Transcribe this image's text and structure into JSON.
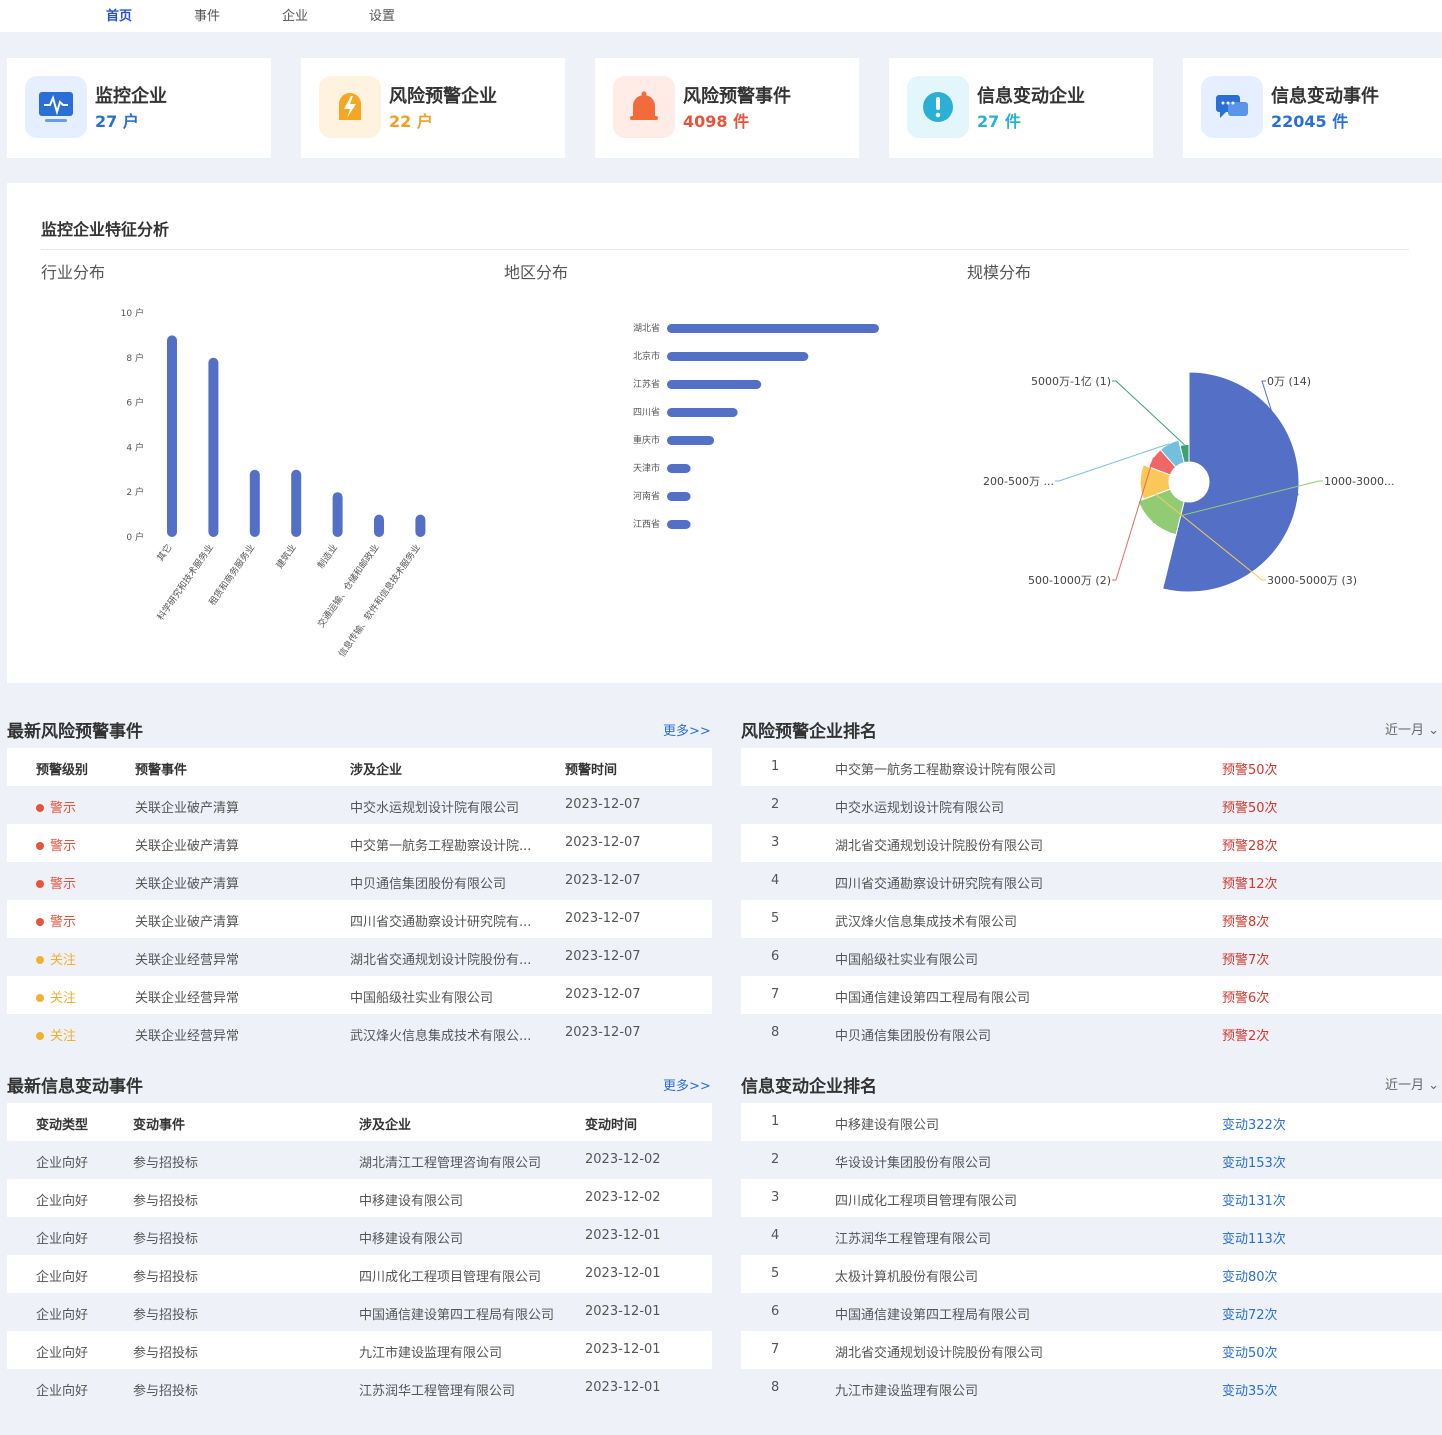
{
  "nav": [
    {
      "label": "首页",
      "active": true
    },
    {
      "label": "事件",
      "active": false
    },
    {
      "label": "企业",
      "active": false
    },
    {
      "label": "设置",
      "active": false
    }
  ],
  "stats": [
    {
      "label": "监控企业",
      "value": "27 户",
      "color": "#2a6fd6",
      "icon": "monitor-icon"
    },
    {
      "label": "风险预警企业",
      "value": "22 户",
      "color": "#f0a020",
      "icon": "lightning-icon"
    },
    {
      "label": "风险预警事件",
      "value": "4098 件",
      "color": "#e8533c",
      "icon": "bell-icon"
    },
    {
      "label": "信息变动企业",
      "value": "27 件",
      "color": "#2ab0d6",
      "icon": "exclamation-icon"
    },
    {
      "label": "信息变动事件",
      "value": "22045 件",
      "color": "#2a6fd6",
      "icon": "message-icon"
    }
  ],
  "analysis": {
    "title": "监控企业特征分析",
    "industry_title": "行业分布",
    "region_title": "地区分布",
    "scale_title": "规模分布"
  },
  "chart_data": [
    {
      "type": "bar",
      "categories": [
        "其它",
        "科学研究和技术服务业",
        "租赁和商务服务业",
        "建筑业",
        "制造业",
        "交通运输、仓储和邮政业",
        "信息传输、软件和信息技术服务业"
      ],
      "values": [
        9,
        8,
        3,
        3,
        2,
        1,
        1
      ],
      "yticks": [
        "0 户",
        "2 户",
        "4 户",
        "6 户",
        "8 户",
        "10 户"
      ],
      "ylim": [
        0,
        10
      ],
      "color": "#5470c6"
    },
    {
      "type": "bar",
      "orientation": "horizontal",
      "categories": [
        "湖北省",
        "北京市",
        "江苏省",
        "四川省",
        "重庆市",
        "天津市",
        "河南省",
        "江西省"
      ],
      "values": [
        9,
        6,
        4,
        3,
        2,
        1,
        1,
        1
      ],
      "color": "#5470c6"
    },
    {
      "type": "pie",
      "rose": true,
      "slices": [
        {
          "label": "0万 (14)",
          "value": 14,
          "color": "#5470c6"
        },
        {
          "label": "1000-3000...",
          "value": 4,
          "color": "#91cc75"
        },
        {
          "label": "3000-5000万 (3)",
          "value": 3,
          "color": "#fac858"
        },
        {
          "label": "500-1000万 (2)",
          "value": 2,
          "color": "#ee6666"
        },
        {
          "label": "200-500万 ...",
          "value": 2,
          "color": "#73c0de"
        },
        {
          "label": "5000万-1亿 (1)",
          "value": 1,
          "color": "#3ba272"
        }
      ]
    }
  ],
  "risk_events": {
    "title": "最新风险预警事件",
    "more": "更多>>",
    "headers": [
      "预警级别",
      "预警事件",
      "涉及企业",
      "预警时间"
    ],
    "rows": [
      {
        "level": "警示",
        "level_color": "#e8533c",
        "event": "关联企业破产清算",
        "company": "中交水运规划设计院有限公司",
        "time": "2023-12-07"
      },
      {
        "level": "警示",
        "level_color": "#e8533c",
        "event": "关联企业破产清算",
        "company": "中交第一航务工程勘察设计院...",
        "time": "2023-12-07"
      },
      {
        "level": "警示",
        "level_color": "#e8533c",
        "event": "关联企业破产清算",
        "company": "中贝通信集团股份有限公司",
        "time": "2023-12-07"
      },
      {
        "level": "警示",
        "level_color": "#e8533c",
        "event": "关联企业破产清算",
        "company": "四川省交通勘察设计研究院有...",
        "time": "2023-12-07"
      },
      {
        "level": "关注",
        "level_color": "#f0b030",
        "event": "关联企业经营异常",
        "company": "湖北省交通规划设计院股份有...",
        "time": "2023-12-07"
      },
      {
        "level": "关注",
        "level_color": "#f0b030",
        "event": "关联企业经营异常",
        "company": "中国船级社实业有限公司",
        "time": "2023-12-07"
      },
      {
        "level": "关注",
        "level_color": "#f0b030",
        "event": "关联企业经营异常",
        "company": "武汉烽火信息集成技术有限公...",
        "time": "2023-12-07"
      }
    ]
  },
  "risk_rank": {
    "title": "风险预警企业排名",
    "range": "近一月",
    "count_color": "#d9342b",
    "rows": [
      {
        "rank": "1",
        "company": "中交第一航务工程勘察设计院有限公司",
        "count": "预警50次"
      },
      {
        "rank": "2",
        "company": "中交水运规划设计院有限公司",
        "count": "预警50次"
      },
      {
        "rank": "3",
        "company": "湖北省交通规划设计院股份有限公司",
        "count": "预警28次"
      },
      {
        "rank": "4",
        "company": "四川省交通勘察设计研究院有限公司",
        "count": "预警12次"
      },
      {
        "rank": "5",
        "company": "武汉烽火信息集成技术有限公司",
        "count": "预警8次"
      },
      {
        "rank": "6",
        "company": "中国船级社实业有限公司",
        "count": "预警7次"
      },
      {
        "rank": "7",
        "company": "中国通信建设第四工程局有限公司",
        "count": "预警6次"
      },
      {
        "rank": "8",
        "company": "中贝通信集团股份有限公司",
        "count": "预警2次"
      }
    ]
  },
  "change_events": {
    "title": "最新信息变动事件",
    "more": "更多>>",
    "headers": [
      "变动类型",
      "变动事件",
      "涉及企业",
      "变动时间"
    ],
    "rows": [
      {
        "type": "企业向好",
        "event": "参与招投标",
        "company": "湖北清江工程管理咨询有限公司",
        "time": "2023-12-02"
      },
      {
        "type": "企业向好",
        "event": "参与招投标",
        "company": "中移建设有限公司",
        "time": "2023-12-02"
      },
      {
        "type": "企业向好",
        "event": "参与招投标",
        "company": "中移建设有限公司",
        "time": "2023-12-01"
      },
      {
        "type": "企业向好",
        "event": "参与招投标",
        "company": "四川成化工程项目管理有限公司",
        "time": "2023-12-01"
      },
      {
        "type": "企业向好",
        "event": "参与招投标",
        "company": "中国通信建设第四工程局有限公司",
        "time": "2023-12-01"
      },
      {
        "type": "企业向好",
        "event": "参与招投标",
        "company": "九江市建设监理有限公司",
        "time": "2023-12-01"
      },
      {
        "type": "企业向好",
        "event": "参与招投标",
        "company": "江苏润华工程管理有限公司",
        "time": "2023-12-01"
      }
    ]
  },
  "change_rank": {
    "title": "信息变动企业排名",
    "range": "近一月",
    "count_color": "#2a6fd6",
    "rows": [
      {
        "rank": "1",
        "company": "中移建设有限公司",
        "count": "变动322次"
      },
      {
        "rank": "2",
        "company": "华设设计集团股份有限公司",
        "count": "变动153次"
      },
      {
        "rank": "3",
        "company": "四川成化工程项目管理有限公司",
        "count": "变动131次"
      },
      {
        "rank": "4",
        "company": "江苏润华工程管理有限公司",
        "count": "变动113次"
      },
      {
        "rank": "5",
        "company": "太极计算机股份有限公司",
        "count": "变动80次"
      },
      {
        "rank": "6",
        "company": "中国通信建设第四工程局有限公司",
        "count": "变动72次"
      },
      {
        "rank": "7",
        "company": "湖北省交通规划设计院股份有限公司",
        "count": "变动50次"
      },
      {
        "rank": "8",
        "company": "九江市建设监理有限公司",
        "count": "变动35次"
      }
    ]
  }
}
